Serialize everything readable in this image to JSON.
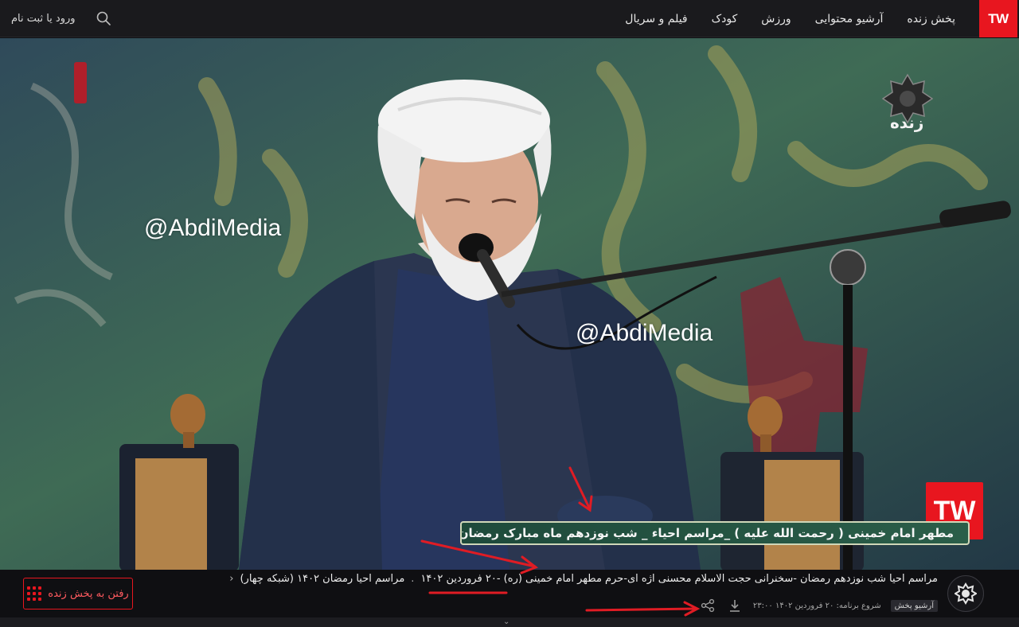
{
  "header": {
    "logo_text": "TW",
    "nav_items": [
      "پخش زنده",
      "آرشیو محتوایی",
      "ورزش",
      "کودک",
      "فیلم و سریال"
    ],
    "login_text": "ورود یا ثبت نام"
  },
  "video": {
    "watermark_1": "@AbdiMedia",
    "watermark_2": "@AbdiMedia",
    "live_label": "زنده",
    "corner_logo": "TW",
    "lower_third": "مطهر امام خمینی ( رحمت الله علیه ) _مراسم احیاء _ شب نوزدهم ماه مبارک رمضان"
  },
  "program": {
    "title_part_1": "مراسم احیا شب نوزدهم رمضان -سخنرانی حجت الاسلام محسنی اژه ای-حرم مطهر امام خمینی (ره) -۲۰ فروردین ۱۴۰۲",
    "title_part_2": "مراسم احیا رمضان ۱۴۰۲ (شبکه چهار)",
    "separator": ".",
    "archive_badge": "آرشیو پخش",
    "start_text": "شروع برنامه: ۲۰ فروردین ۱۴۰۲ ۲۳:۰۰",
    "live_button": "رفتن به پخش زنده"
  },
  "colors": {
    "brand_red": "#e8161f",
    "bar_bg": "#0f0f12",
    "annotation_red": "#e01c24"
  },
  "icons": [
    "search-icon",
    "share-icon",
    "download-icon",
    "grid-icon",
    "channel-logo",
    "chevron-left-icon",
    "chevron-down-icon"
  ]
}
